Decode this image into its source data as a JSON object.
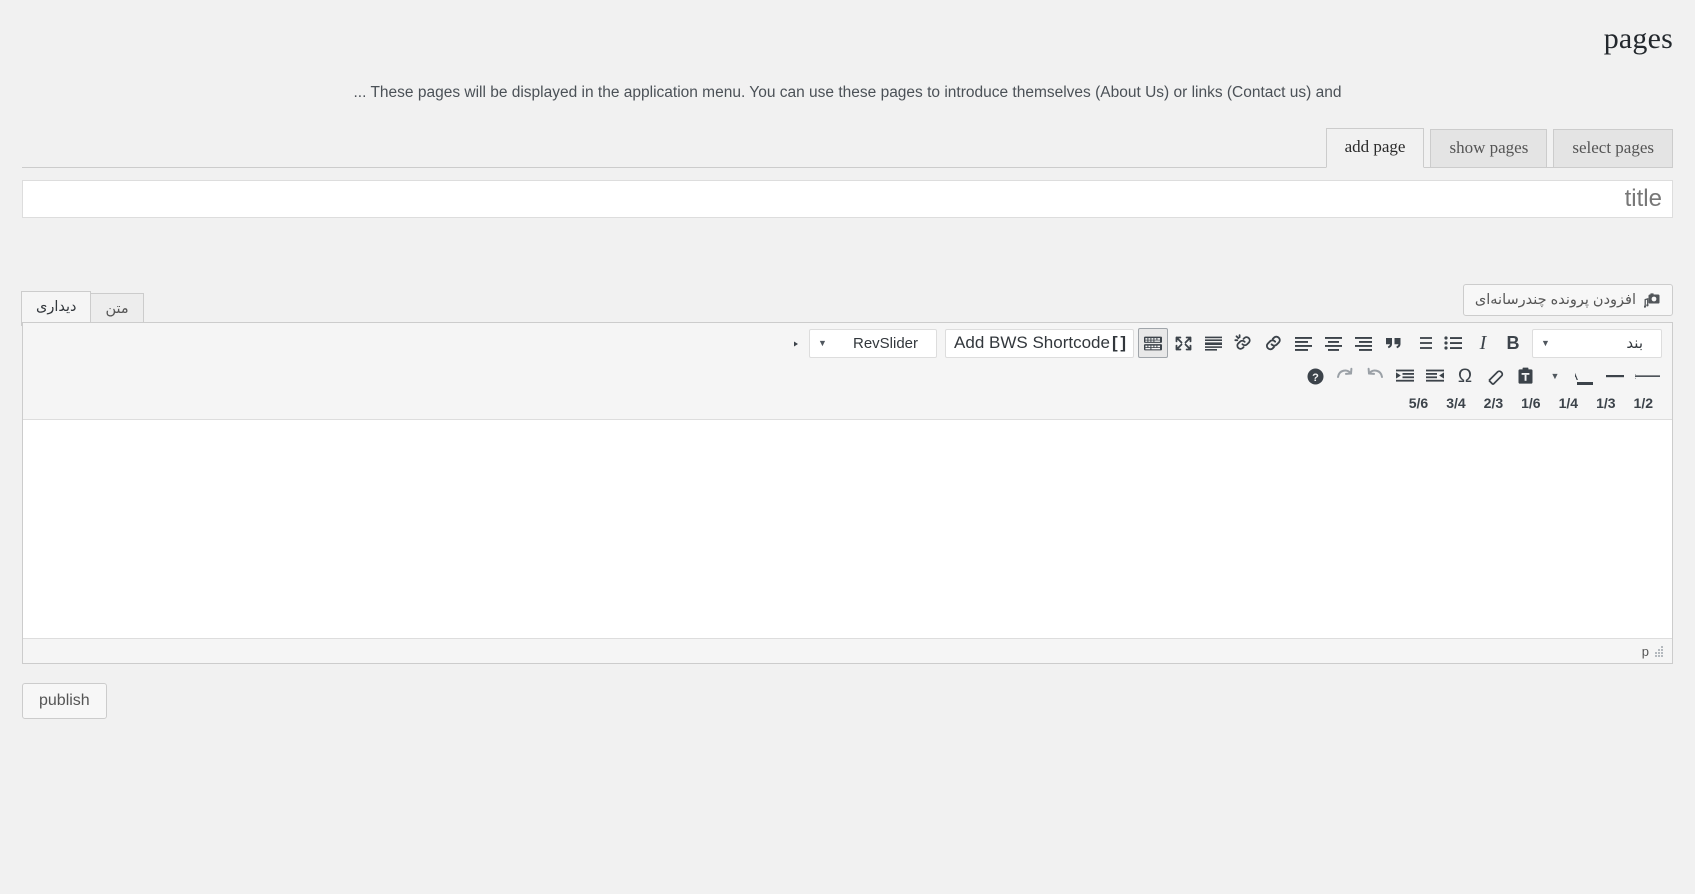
{
  "header": {
    "title": "pages",
    "description": "... These pages will be displayed in the application menu. You can use these pages to introduce themselves (About Us) or links (Contact us) and"
  },
  "tabs": [
    {
      "label": "select pages",
      "active": false
    },
    {
      "label": "show pages",
      "active": false
    },
    {
      "label": "add page",
      "active": true
    }
  ],
  "title_field": {
    "value": "",
    "placeholder": "title"
  },
  "media": {
    "button_label": "افزودن پرونده چندرسانه‌ای",
    "icon": "media-add-icon"
  },
  "editor_tabs": [
    {
      "label": "دیداری",
      "active": true,
      "name": "visual"
    },
    {
      "label": "متن",
      "active": false,
      "name": "text"
    }
  ],
  "toolbar": {
    "row1": {
      "paragraph_select": "بند",
      "bold": "B",
      "italic": "I",
      "bullet_list": "bullet-list-icon",
      "numbered_list": "numbered-list-icon",
      "blockquote": "blockquote-icon",
      "align_right": "align-right-icon",
      "align_center": "align-center-icon",
      "align_left": "align-left-icon",
      "insert_link": "link-icon",
      "remove_link": "unlink-icon",
      "read_more": "read-more-icon",
      "fullscreen": "fullscreen-icon",
      "toolbar_toggle": "keyboard-toolbar-icon",
      "shortcode_button": "Add BWS Shortcode",
      "shortcode_brackets": "[ ]",
      "revslider_select": "RevSlider",
      "paragraph_mark": "pilcrow-icon"
    },
    "row2": {
      "strikethrough": "ABC",
      "horizontal_rule": "horizontal-rule-icon",
      "text_color": "A",
      "text_color_caret": "chevron-down-icon",
      "paste_text": "paste-as-text-icon",
      "clear_formatting": "eraser-icon",
      "special_character": "Ω",
      "outdent": "outdent-icon",
      "indent": "indent-icon",
      "undo": "undo-icon",
      "redo": "redo-icon",
      "help": "help-icon"
    },
    "fractions": [
      "1/2",
      "1/3",
      "1/4",
      "1/6",
      "2/3",
      "3/4",
      "5/6"
    ]
  },
  "editor_body": {
    "content": ""
  },
  "statusbar": {
    "path": "p",
    "resize_handle": "resize-grip-icon"
  },
  "footer": {
    "publish_label": "publish"
  },
  "colors": {
    "page_bg": "#f1f1f1",
    "panel_bg": "#ffffff",
    "toolbar_bg": "#f5f5f5",
    "border": "#cccccc",
    "text": "#32373c",
    "muted_text": "#555555"
  }
}
